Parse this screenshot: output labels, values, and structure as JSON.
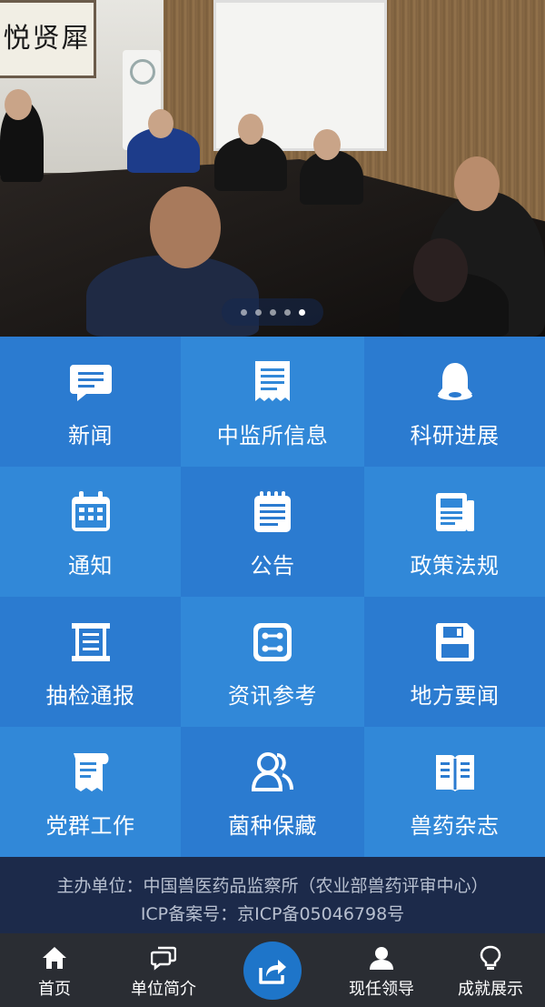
{
  "banner": {
    "calligraphy": "悦贤犀",
    "slides": 5,
    "active_slide": 5
  },
  "menu": [
    {
      "label": "新闻",
      "icon": "chat-icon"
    },
    {
      "label": "中监所信息",
      "icon": "receipt-icon"
    },
    {
      "label": "科研进展",
      "icon": "bell-icon"
    },
    {
      "label": "通知",
      "icon": "calendar-icon"
    },
    {
      "label": "公告",
      "icon": "notepad-icon"
    },
    {
      "label": "政策法规",
      "icon": "newspaper-icon"
    },
    {
      "label": "抽检通报",
      "icon": "list-icon"
    },
    {
      "label": "资讯参考",
      "icon": "nodes-icon"
    },
    {
      "label": "地方要闻",
      "icon": "floppy-icon"
    },
    {
      "label": "党群工作",
      "icon": "flag-doc-icon"
    },
    {
      "label": "菌种保藏",
      "icon": "people-icon"
    },
    {
      "label": "兽药杂志",
      "icon": "book-icon"
    }
  ],
  "footer": {
    "line1": "主办单位：中国兽医药品监察所（农业部兽药评审中心）",
    "line2": "ICP备案号：京ICP备05046798号"
  },
  "nav": {
    "home": "首页",
    "about": "单位简介",
    "leaders": "现任领导",
    "achievements": "成就展示"
  },
  "colors": {
    "grid_blue": "#2b7bd0",
    "footer_bg": "#1c2a4a",
    "nav_bg": "#2a2d33",
    "share_blue": "#1e75c9"
  }
}
